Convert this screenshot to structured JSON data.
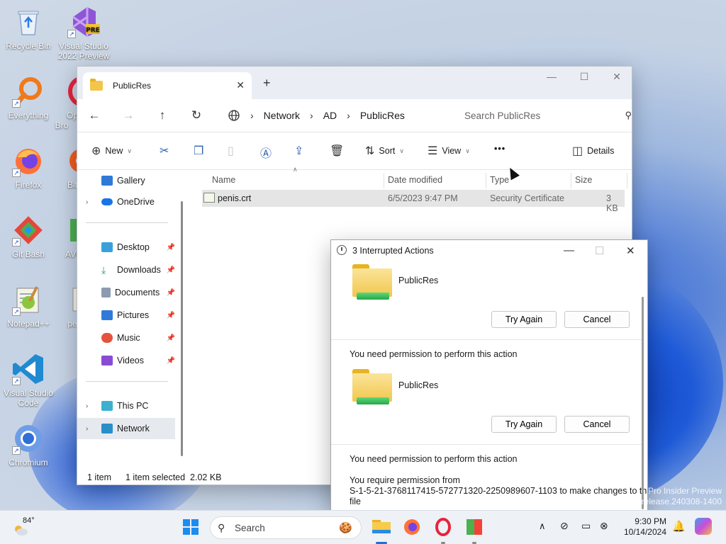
{
  "desktop": {
    "icons": [
      {
        "label": "Recycle Bin",
        "icon": "recycle-bin-icon"
      },
      {
        "label": "Visual Studio 2022 Preview",
        "icon": "visual-studio-preview-icon",
        "badge": "PRE"
      },
      {
        "label": "Everything",
        "icon": "everything-search-icon"
      },
      {
        "label": "Op Bro",
        "icon": "opera-browser-icon"
      },
      {
        "label": "Firefox",
        "icon": "firefox-icon"
      },
      {
        "label": "Bit",
        "icon": "bit-app-icon"
      },
      {
        "label": "Git Bash",
        "icon": "git-bash-icon"
      },
      {
        "label": "AVG",
        "icon": "avg-icon"
      },
      {
        "label": "Notepad++",
        "icon": "notepadpp-icon"
      },
      {
        "label": "pe",
        "icon": "file-icon"
      },
      {
        "label": "Visual Studio Code",
        "icon": "vscode-icon"
      },
      {
        "label": "Chromium",
        "icon": "chromium-icon"
      }
    ],
    "watermark": {
      "line1": "Pro Insider Preview",
      "line2": "release.240308-1400"
    }
  },
  "explorer": {
    "tab_title": "PublicRes",
    "new_tab": "+",
    "breadcrumb": [
      "Network",
      "AD",
      "PublicRes"
    ],
    "search_placeholder": "Search PublicRes",
    "commands": {
      "new": "New",
      "sort": "Sort",
      "view": "View",
      "more": "•••",
      "details": "Details"
    },
    "sidebar": {
      "gallery": "Gallery",
      "onedrive": "OneDrive",
      "desktop": "Desktop",
      "downloads": "Downloads",
      "documents": "Documents",
      "pictures": "Pictures",
      "music": "Music",
      "videos": "Videos",
      "thispc": "This PC",
      "network": "Network"
    },
    "columns": {
      "name": "Name",
      "date": "Date modified",
      "type": "Type",
      "size": "Size"
    },
    "files": [
      {
        "name": "penis.crt",
        "date": "6/5/2023 9:47 PM",
        "type": "Security Certificate",
        "size": "3 KB"
      }
    ],
    "status": {
      "count": "1 item",
      "selected": "1 item selected  2.02 KB"
    }
  },
  "dialog": {
    "title": "3 Interrupted Actions",
    "items": [
      {
        "name": "PublicRes",
        "retry": "Try Again",
        "cancel": "Cancel"
      },
      {
        "message": "You need permission to perform this action",
        "name": "PublicRes",
        "retry": "Try Again",
        "cancel": "Cancel"
      },
      {
        "message": "You need permission to perform this action",
        "detail1": "You require permission from",
        "detail2": "S-1-5-21-3768117415-572771320-2250989607-1103 to make changes to this",
        "detail3": "file"
      }
    ]
  },
  "taskbar": {
    "weather_temp": "84°",
    "search_label": "Search",
    "time": "9:30 PM",
    "date": "10/14/2024"
  }
}
